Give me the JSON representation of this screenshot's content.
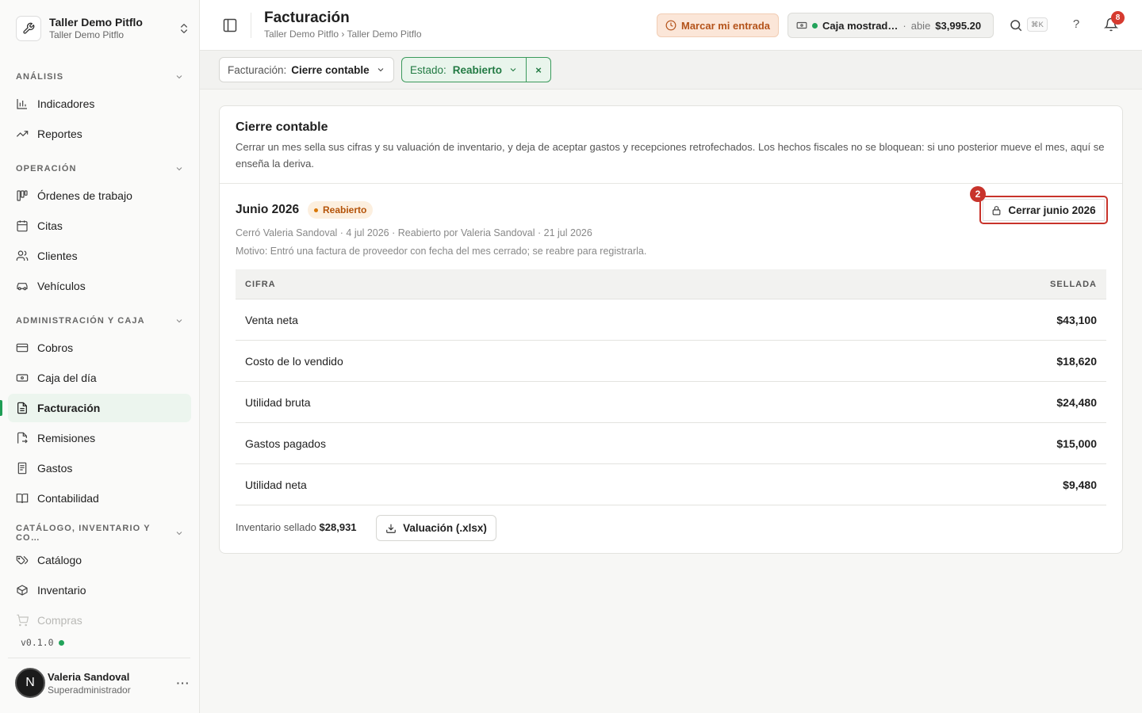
{
  "org": {
    "name": "Taller Demo Pitflo",
    "subtitle": "Taller Demo Pitflo"
  },
  "sidebar": {
    "sections": [
      {
        "title": "ANÁLISIS"
      },
      {
        "title": "OPERACIÓN"
      },
      {
        "title": "ADMINISTRACIÓN Y CAJA"
      },
      {
        "title": "CATÁLOGO, INVENTARIO Y CO…"
      }
    ],
    "items": [
      {
        "label": "Indicadores",
        "icon": "bar-chart-icon"
      },
      {
        "label": "Reportes",
        "icon": "trending-up-icon"
      },
      {
        "label": "Órdenes de trabajo",
        "icon": "kanban-icon"
      },
      {
        "label": "Citas",
        "icon": "calendar-icon"
      },
      {
        "label": "Clientes",
        "icon": "users-icon"
      },
      {
        "label": "Vehículos",
        "icon": "car-icon"
      },
      {
        "label": "Cobros",
        "icon": "credit-card-icon"
      },
      {
        "label": "Caja del día",
        "icon": "banknote-icon"
      },
      {
        "label": "Facturación",
        "icon": "file-text-icon",
        "active": true
      },
      {
        "label": "Remisiones",
        "icon": "file-export-icon"
      },
      {
        "label": "Gastos",
        "icon": "receipt-icon"
      },
      {
        "label": "Contabilidad",
        "icon": "book-open-icon"
      },
      {
        "label": "Catálogo",
        "icon": "tags-icon"
      },
      {
        "label": "Inventario",
        "icon": "package-icon"
      },
      {
        "label": "Compras",
        "icon": "shopping-cart-icon"
      }
    ],
    "version": "v0.1.0"
  },
  "user": {
    "initial": "N",
    "name": "Valeria Sandoval",
    "role": "Superadministrador"
  },
  "topbar": {
    "title": "Facturación",
    "breadcrumb": "Taller Demo Pitflo › Taller Demo Pitflo",
    "clockin_label": "Marcar mi entrada",
    "caja_name": "Caja mostrad…",
    "caja_sep": "·",
    "caja_status": "abie",
    "caja_amount": "$3,995.20",
    "search_shortcut": "⌘K",
    "help": "?",
    "notifications_count": "8"
  },
  "filters": {
    "facturacion_label": "Facturación:",
    "facturacion_value": "Cierre contable",
    "estado_label": "Estado:",
    "estado_value": "Reabierto",
    "clear": "×"
  },
  "card": {
    "title": "Cierre contable",
    "description": "Cerrar un mes sella sus cifras y su valuación de inventario, y deja de aceptar gastos y recepciones retrofechados. Los hechos fiscales no se bloquean: si uno posterior mueve el mes, aquí se enseña la deriva.",
    "month": "Junio 2026",
    "status_badge": "Reabierto",
    "closed_line": "Cerró Valeria Sandoval · 4 jul 2026 · Reabierto por Valeria Sandoval · 21 jul 2026",
    "motivo": "Motivo: Entró una factura de proveedor con fecha del mes cerrado; se reabre para registrarla.",
    "close_button": "Cerrar junio 2026",
    "step_number": "2",
    "table": {
      "col_label": "CIFRA",
      "col_value": "SELLADA",
      "rows": [
        {
          "label": "Venta neta",
          "value": "$43,100"
        },
        {
          "label": "Costo de lo vendido",
          "value": "$18,620"
        },
        {
          "label": "Utilidad bruta",
          "value": "$24,480"
        },
        {
          "label": "Gastos pagados",
          "value": "$15,000"
        },
        {
          "label": "Utilidad neta",
          "value": "$9,480"
        }
      ]
    },
    "inventory_label": "Inventario sellado",
    "inventory_value": "$28,931",
    "download_button": "Valuación (.xlsx)"
  },
  "colors": {
    "accent": "#1f9d55",
    "danger": "#c8332b",
    "warning": "#b45309"
  }
}
